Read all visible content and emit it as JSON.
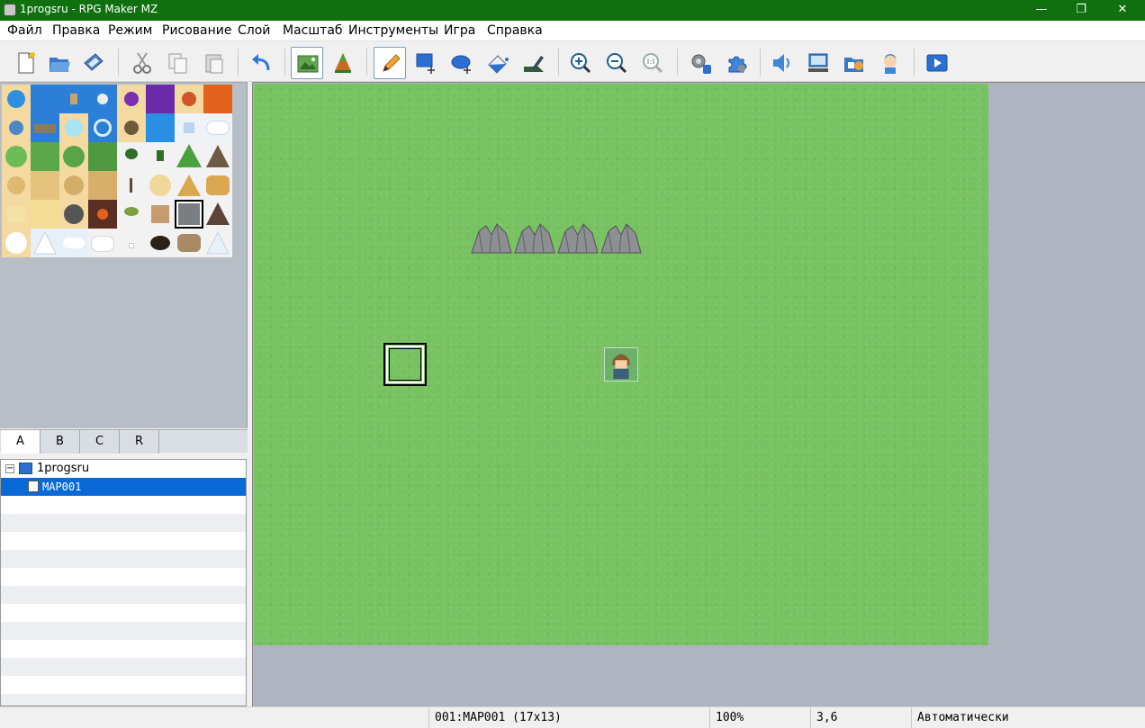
{
  "window": {
    "title": "1progsru - RPG Maker MZ",
    "controls": {
      "minimize": "—",
      "maximize": "❐",
      "close": "✕"
    }
  },
  "menu": {
    "items": [
      "Файл",
      "Правка",
      "Режим",
      "Рисование",
      "Слой",
      "Масштаб",
      "Инструменты",
      "Игра",
      "Справка"
    ]
  },
  "toolbar": {
    "buttons": [
      {
        "icon": "new-project-icon"
      },
      {
        "icon": "open-project-icon"
      },
      {
        "icon": "save-project-icon"
      },
      {
        "icon": "cut-icon"
      },
      {
        "icon": "copy-icon"
      },
      {
        "icon": "paste-icon"
      },
      {
        "icon": "undo-icon"
      },
      {
        "icon": "map-mode-icon",
        "active": true
      },
      {
        "icon": "event-mode-icon"
      },
      {
        "icon": "pencil-icon",
        "active": true
      },
      {
        "icon": "rectangle-icon"
      },
      {
        "icon": "ellipse-icon"
      },
      {
        "icon": "fill-icon"
      },
      {
        "icon": "shadow-pen-icon"
      },
      {
        "icon": "zoom-in-icon"
      },
      {
        "icon": "zoom-out-icon"
      },
      {
        "icon": "zoom-actual-icon"
      },
      {
        "icon": "database-icon"
      },
      {
        "icon": "plugin-manager-icon"
      },
      {
        "icon": "sound-test-icon"
      },
      {
        "icon": "event-searcher-icon"
      },
      {
        "icon": "resource-manager-icon"
      },
      {
        "icon": "character-generator-icon"
      },
      {
        "icon": "playtest-icon"
      }
    ]
  },
  "palette": {
    "tabs": [
      "A",
      "B",
      "C",
      "R"
    ],
    "active_tab": "A"
  },
  "map_tree": {
    "project": "1progsru",
    "maps": [
      "MAP001"
    ],
    "selected": "MAP001"
  },
  "status": {
    "map": "001:MAP001 (17x13)",
    "zoom": "100%",
    "coords": "3,6",
    "mode": "Автоматически"
  },
  "colors": {
    "titlebar": "#107010",
    "grass": "#78c262",
    "selection": "#0a69d6",
    "map_bg": "#aeb5c0"
  }
}
